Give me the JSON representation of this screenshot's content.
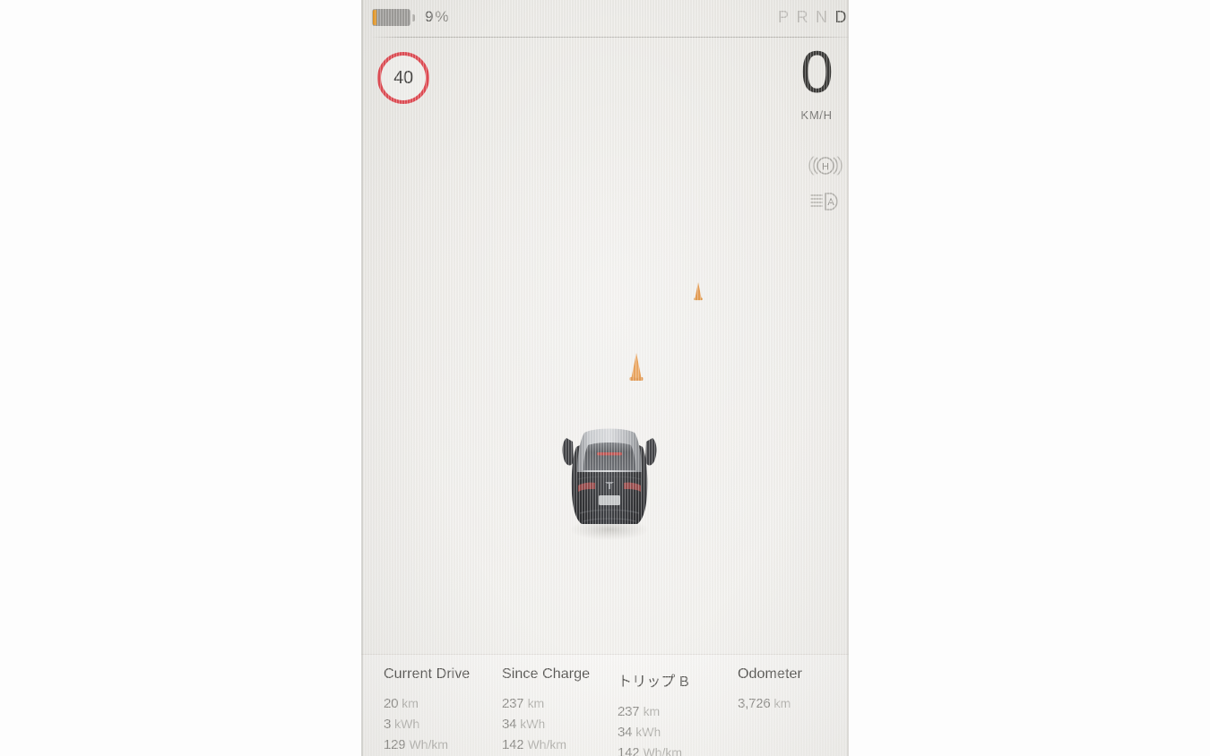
{
  "display": {
    "kind": "tesla-driving-display",
    "background_color": "#eceae6"
  },
  "status_bar": {
    "battery": {
      "icon": "battery-icon",
      "percent_value": "9",
      "percent_unit": "%",
      "fill_color": "#e8971f",
      "body_color": "#9d9c99"
    },
    "gears": [
      {
        "label": "P",
        "active": false
      },
      {
        "label": "R",
        "active": false
      },
      {
        "label": "N",
        "active": false
      },
      {
        "label": "D",
        "active": true
      }
    ]
  },
  "speed_limit": {
    "icon": "speed-limit-sign-icon",
    "value": "40",
    "ring_color": "#e04a52"
  },
  "speedometer": {
    "value": "0",
    "unit": "KM/H"
  },
  "indicators": [
    {
      "icon": "auto-hold-icon",
      "label": "H",
      "state": "inactive"
    },
    {
      "icon": "auto-high-beam-icon",
      "label": "A",
      "state": "inactive"
    }
  ],
  "road_scene": {
    "ego_vehicle": {
      "icon": "ego-vehicle-icon",
      "model": "tesla-rear-view",
      "body_color": "#15161a"
    },
    "objects": [
      {
        "icon": "traffic-cone-icon",
        "label": "traffic cone",
        "color": "#e08227",
        "distance": "near"
      },
      {
        "icon": "traffic-cone-icon",
        "label": "traffic cone",
        "color": "#e08227",
        "distance": "far"
      }
    ]
  },
  "trip_panel": {
    "columns": [
      {
        "title": "Current Drive",
        "rows": [
          {
            "value": "20",
            "unit": "km"
          },
          {
            "value": "3",
            "unit": "kWh"
          },
          {
            "value": "129",
            "unit": "Wh/km"
          }
        ]
      },
      {
        "title": "Since Charge",
        "rows": [
          {
            "value": "237",
            "unit": "km"
          },
          {
            "value": "34",
            "unit": "kWh"
          },
          {
            "value": "142",
            "unit": "Wh/km"
          }
        ]
      },
      {
        "title": "トリップ B",
        "rows": [
          {
            "value": "237",
            "unit": "km"
          },
          {
            "value": "34",
            "unit": "kWh"
          },
          {
            "value": "142",
            "unit": "Wh/km"
          }
        ]
      },
      {
        "title": "Odometer",
        "rows": [
          {
            "value": "3,726",
            "unit": "km"
          }
        ]
      }
    ]
  }
}
